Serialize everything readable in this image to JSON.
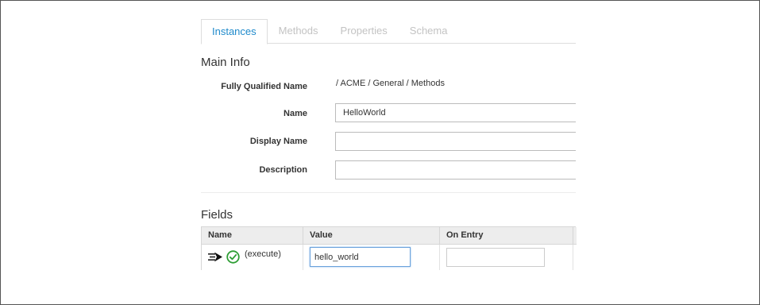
{
  "tabs": [
    {
      "label": "Instances",
      "active": true
    },
    {
      "label": "Methods",
      "active": false
    },
    {
      "label": "Properties",
      "active": false
    },
    {
      "label": "Schema",
      "active": false
    }
  ],
  "main_info": {
    "title": "Main Info",
    "fqn_label": "Fully Qualified Name",
    "fqn_value": "/ ACME / General / Methods",
    "name_label": "Name",
    "name_value": "HelloWorld",
    "display_name_label": "Display Name",
    "display_name_value": "",
    "description_label": "Description",
    "description_value": ""
  },
  "fields": {
    "title": "Fields",
    "columns": [
      "Name",
      "Value",
      "On Entry"
    ],
    "rows": [
      {
        "name": "(execute)",
        "value": "hello_world",
        "on_entry": "",
        "icons": [
          "execute-arrow-icon",
          "check-circle-icon"
        ]
      }
    ]
  },
  "colors": {
    "accent": "#1f8acb",
    "success": "#2e9e35",
    "focus_border": "#6aa2dc"
  }
}
